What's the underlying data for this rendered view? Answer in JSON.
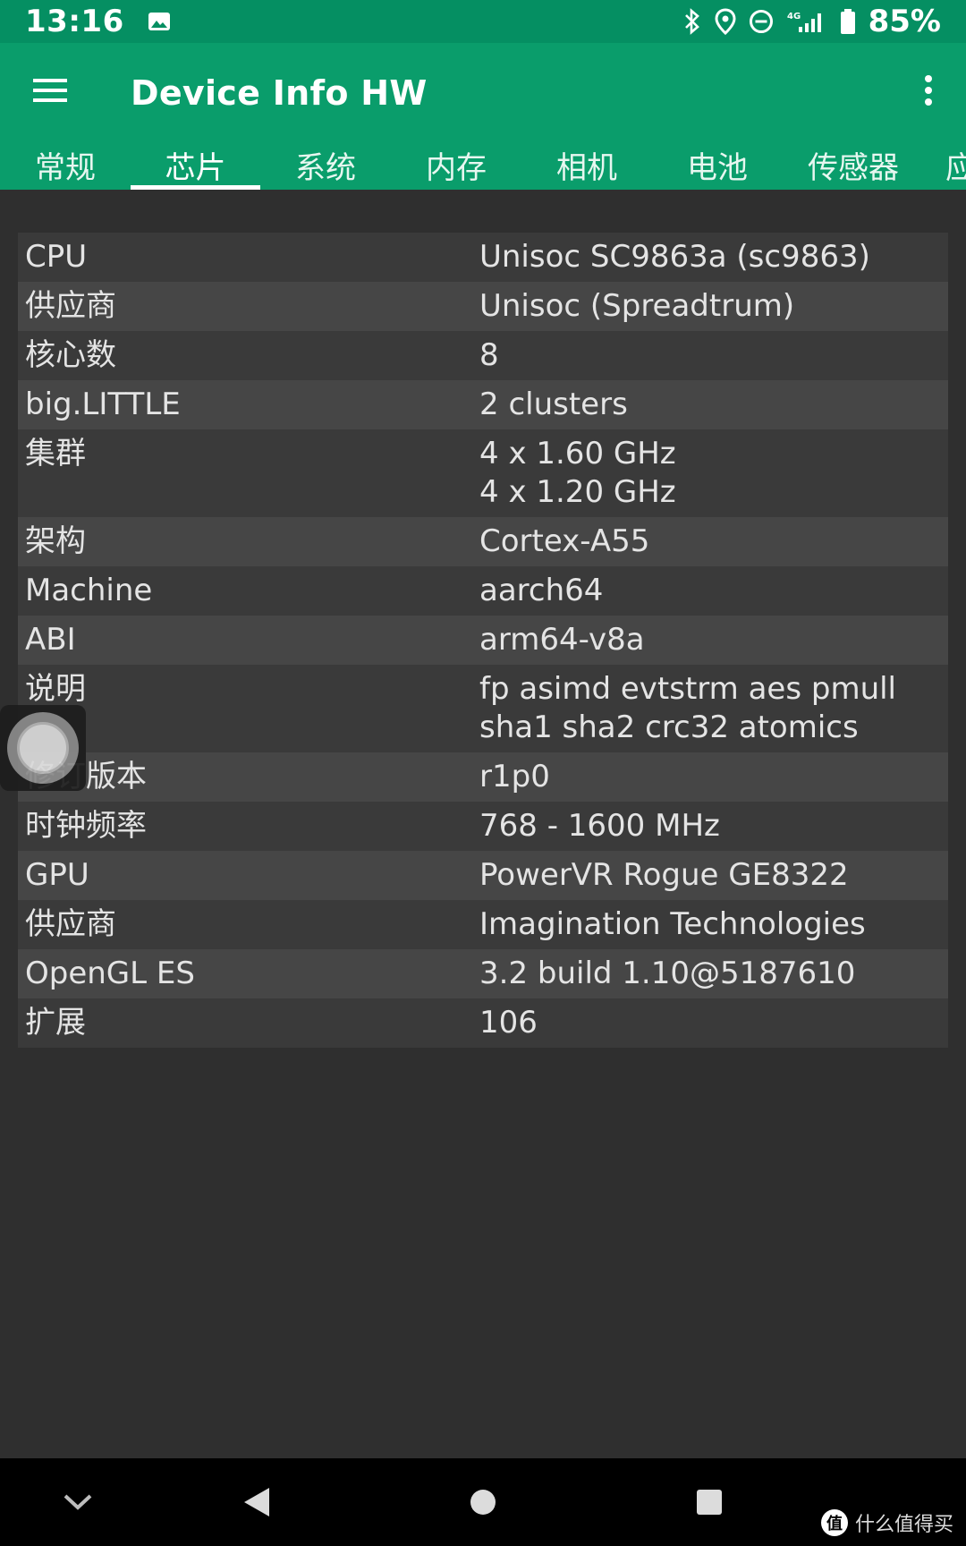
{
  "status_bar": {
    "time": "13:16",
    "battery": "85%"
  },
  "app_bar": {
    "title": "Device Info HW"
  },
  "tabs": [
    {
      "label": "常规"
    },
    {
      "label": "芯片"
    },
    {
      "label": "系统"
    },
    {
      "label": "内存"
    },
    {
      "label": "相机"
    },
    {
      "label": "电池"
    },
    {
      "label": "传感器"
    },
    {
      "label": "应"
    }
  ],
  "active_tab": "芯片",
  "rows": [
    {
      "label": "CPU",
      "value": "Unisoc SC9863a (sc9863)"
    },
    {
      "label": "供应商",
      "value": "Unisoc (Spreadtrum)"
    },
    {
      "label": "核心数",
      "value": "8"
    },
    {
      "label": "big.LITTLE",
      "value": "2 clusters"
    },
    {
      "label": "集群",
      "value": "4 x 1.60 GHz",
      "value2": "4 x 1.20 GHz"
    },
    {
      "label": "架构",
      "value": "Cortex-A55"
    },
    {
      "label": "Machine",
      "value": "aarch64"
    },
    {
      "label": "ABI",
      "value": "arm64-v8a"
    },
    {
      "label": "说明",
      "value": "fp asimd evtstrm aes pmull",
      "value2": "sha1 sha2 crc32 atomics"
    },
    {
      "label": "修订版本",
      "value": "r1p0"
    },
    {
      "label": "时钟频率",
      "value": "768 - 1600 MHz"
    },
    {
      "label": "GPU",
      "value": "PowerVR Rogue GE8322"
    },
    {
      "label": "供应商",
      "value": "Imagination Technologies"
    },
    {
      "label": "OpenGL ES",
      "value": "3.2 build 1.10@5187610"
    },
    {
      "label": "扩展",
      "value": "106"
    }
  ],
  "watermark": {
    "badge": "值",
    "text": "什么值得买"
  },
  "icons": {
    "status": [
      "image-icon",
      "bluetooth-icon",
      "location-icon",
      "dnd-icon",
      "signal-4g-icon",
      "battery-icon"
    ],
    "app_bar": [
      "menu-icon",
      "more-vert-icon"
    ],
    "nav": [
      "collapse-down-icon",
      "back-icon",
      "home-icon",
      "recents-icon"
    ]
  },
  "colors": {
    "status_bar": "#058f62",
    "app_bar": "#0a9d6b",
    "background": "#2f2f2f",
    "row": "#3a3a3a",
    "row_alt": "#464646"
  }
}
